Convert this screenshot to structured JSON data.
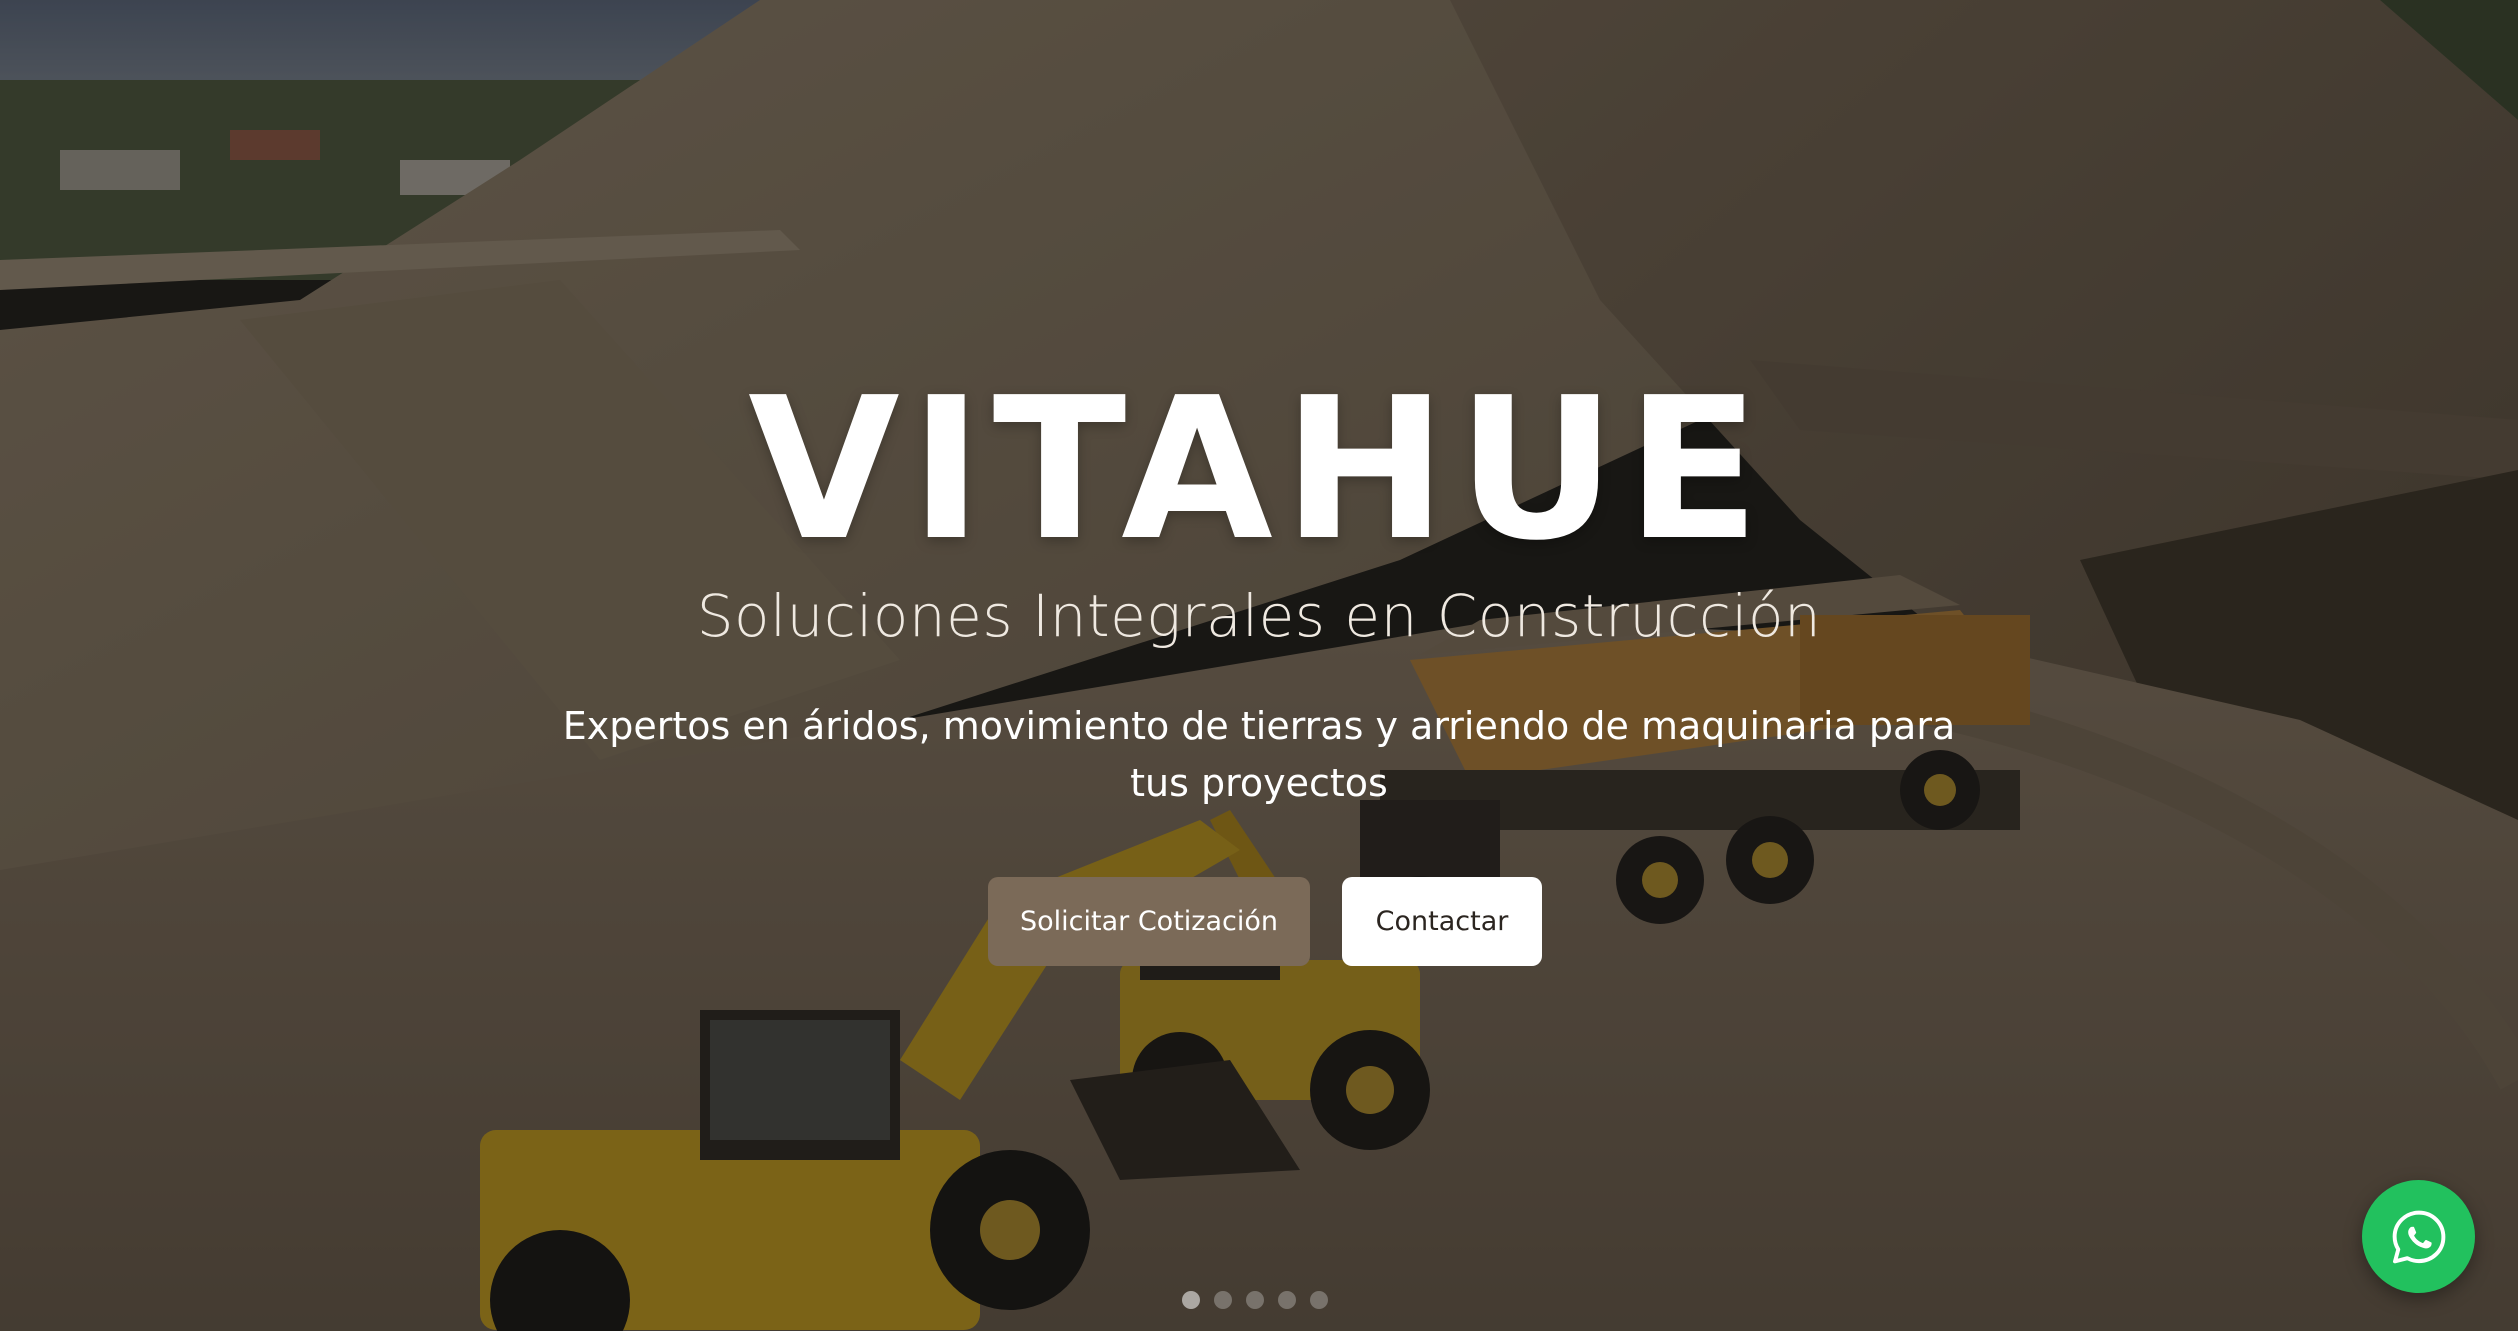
{
  "hero": {
    "brand": "VITAHUE",
    "tagline": "Soluciones Integrales en Construcción",
    "description": "Expertos en áridos, movimiento de tierras y arriendo de maquinaria para tus proyectos",
    "background_image": "construction-site-excavator-dump-truck"
  },
  "actions": {
    "quote_label": "Solicitar Cotización",
    "contact_label": "Contactar"
  },
  "carousel": {
    "slide_count": 5,
    "active_index": 0
  },
  "floating": {
    "whatsapp_icon": "whatsapp-icon"
  },
  "colors": {
    "primary_button": "#7b6a58",
    "secondary_button": "#ffffff",
    "whatsapp": "#22c15e",
    "overlay": "rgba(0,0,0,0.45)"
  }
}
